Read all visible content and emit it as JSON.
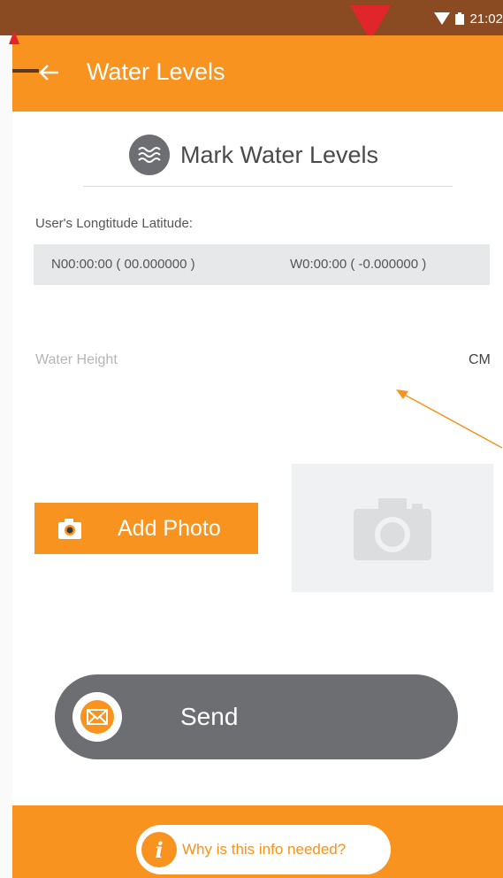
{
  "status_bar": {
    "time": "21:02",
    "icons": [
      "wifi-icon",
      "battery-icon"
    ]
  },
  "app_bar": {
    "title": "Water Levels",
    "back_icon": "arrow-left-icon"
  },
  "section": {
    "title": "Mark Water Levels",
    "icon": "waves-icon"
  },
  "coordinates": {
    "label": "User's Longtitude Latitude:",
    "latitude": "N00:00:00 ( 00.000000 )",
    "longitude": "W0:00:00 ( -0.000000 )"
  },
  "water_height": {
    "placeholder": "Water Height",
    "value": "",
    "unit": "CM"
  },
  "photo": {
    "add_label": "Add Photo",
    "button_icon": "camera-icon",
    "placeholder_icon": "camera-icon"
  },
  "send": {
    "label": "Send",
    "icon": "envelope-icon"
  },
  "footer": {
    "info_label": "Why is this info needed?",
    "info_icon": "info-icon"
  },
  "colors": {
    "primary": "#f7931e",
    "status_bar": "#8a4a22",
    "dark_gray": "#6d6e71",
    "light_gray": "#e7e8ea",
    "accent_red": "#e0262b"
  }
}
